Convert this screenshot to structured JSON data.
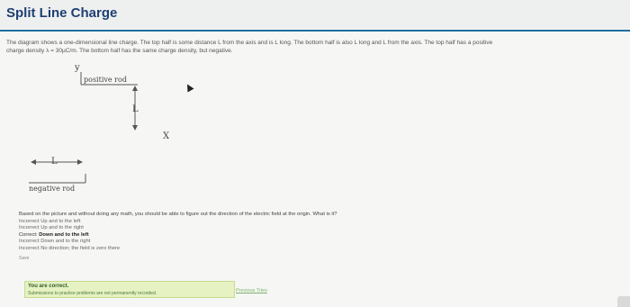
{
  "header": {
    "title": "Split Line Charge"
  },
  "description": {
    "line1": "The diagram shows a one-dimensional line charge. The top half is some distance L from the axis and is L long. The bottom half is also L long and L from the axis. The top half has a positive",
    "line2": "charge density λ = 30μC/m. The bottom half has the same charge density, but negative."
  },
  "figure": {
    "y_label": "y",
    "x_label": "X",
    "positive_label": "positive rod",
    "negative_label": "negative rod",
    "vertical_L": "L",
    "horizontal_L": "L"
  },
  "question": {
    "prompt": "Based on the picture and without doing any math, you should be able to figure out the direction of the electric field at the origin. What is it?",
    "options": [
      {
        "status": "Incorrect",
        "text": "Up and to the left"
      },
      {
        "status": "Incorrect",
        "text": "Up and to the right"
      },
      {
        "status": "Correct:",
        "text": "Down and to the left"
      },
      {
        "status": "Incorrect",
        "text": "Down and to the right"
      },
      {
        "status": "Incorrect",
        "text": "No direction; the field is zero there"
      }
    ],
    "save_label": "Save"
  },
  "result": {
    "title": "You are correct.",
    "note": "Submissions to practice problems are not permanently recorded.",
    "previous_link": "Previous Tries"
  }
}
